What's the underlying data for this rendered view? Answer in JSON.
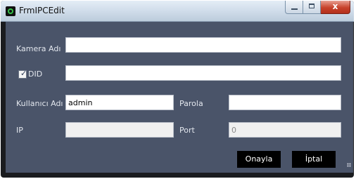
{
  "window": {
    "title": "FrmIPCEdit",
    "close_glyph": "x",
    "icons": {
      "app": "app-icon",
      "minimize": "minimize-icon",
      "maximize": "maximize-icon",
      "close": "close-icon",
      "check": "check-icon",
      "grip": "resize-grip-icon"
    }
  },
  "form": {
    "camera_name_label": "Kamera Adı",
    "camera_name_value": "",
    "did_label": "DID",
    "did_checked": true,
    "did_value": "",
    "username_label": "Kullanıcı Adı",
    "username_value": "admin",
    "password_label": "Parola",
    "password_value": "",
    "ip_label": "IP",
    "ip_value": "",
    "port_label": "Port",
    "port_value": "0"
  },
  "buttons": {
    "confirm_label": "Onayla",
    "cancel_label": "İptal"
  },
  "colors": {
    "panel_background": "#4a5469",
    "frame": "#1a1c1f",
    "button_background": "#000000"
  }
}
